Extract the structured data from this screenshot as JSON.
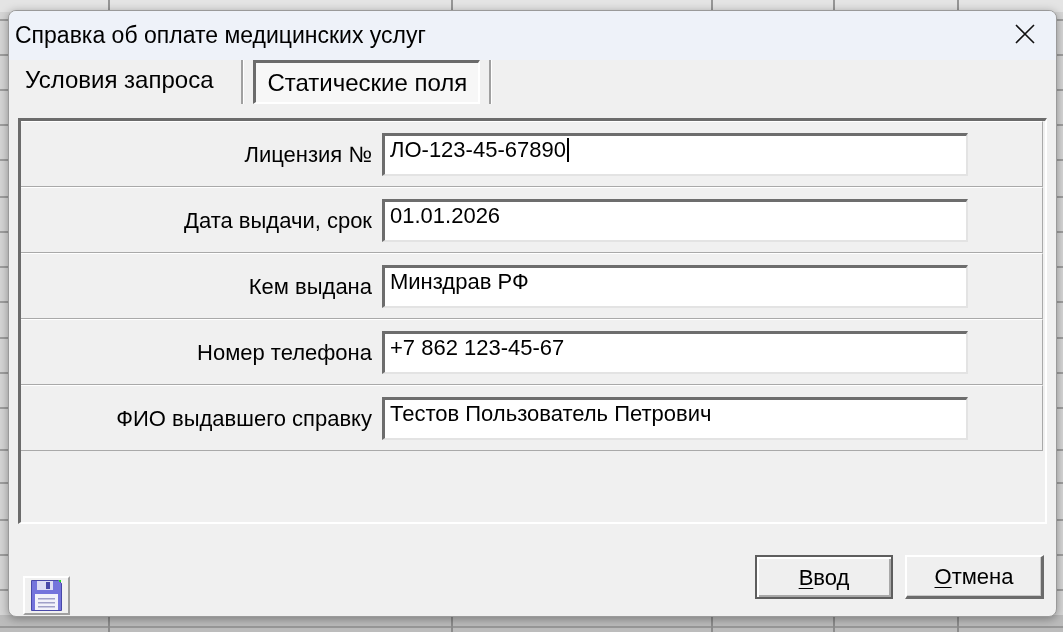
{
  "window": {
    "title": "Справка об оплате медицинских услуг"
  },
  "tabs": [
    {
      "label": "Условия запроса",
      "selected": false
    },
    {
      "label": "Статические поля",
      "selected": true
    }
  ],
  "fields": [
    {
      "label": "Лицензия №",
      "value": "ЛО-123-45-67890",
      "focused": true
    },
    {
      "label": "Дата выдачи, срок",
      "value": "01.01.2026",
      "focused": false
    },
    {
      "label": "Кем выдана",
      "value": "Минздрав РФ",
      "focused": false
    },
    {
      "label": "Номер телефона",
      "value": "+7 862 123-45-67",
      "focused": false
    },
    {
      "label": "ФИО выдавшего справку",
      "value": "Тестов Пользователь Петрович",
      "focused": false
    }
  ],
  "buttons": [
    {
      "label": "Ввод",
      "mnemonic_underlined": true,
      "default": true
    },
    {
      "label": "Отмена",
      "mnemonic_underlined": true,
      "default": false
    }
  ]
}
